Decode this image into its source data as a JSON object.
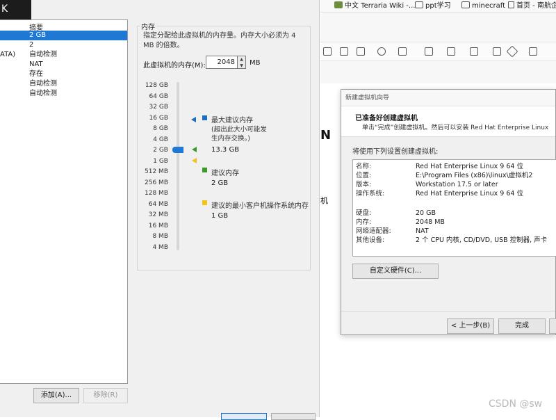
{
  "settings": {
    "close_glyph": "K",
    "list_header": "摘要",
    "rows": [
      {
        "device": "",
        "summary": "2 GB",
        "selected": true
      },
      {
        "device": "",
        "summary": "2"
      },
      {
        "device": "ATA)",
        "summary": "自动检测"
      },
      {
        "device": "",
        "summary": "NAT"
      },
      {
        "device": "",
        "summary": "存在"
      },
      {
        "device": "",
        "summary": "自动检测"
      },
      {
        "device": "",
        "summary": "自动检测"
      }
    ],
    "add_button": "添加(A)...",
    "remove_button": "移除(R)",
    "memory_group_title": "内存",
    "memory_desc": "指定分配给此虚拟机的内存量。内存大小必须为 4 MB 的倍数。",
    "memory_label": "此虚拟机的内存(M):",
    "memory_value": "2048",
    "memory_unit": "MB",
    "scale_labels": [
      "128 GB",
      "64 GB",
      "32 GB",
      "16 GB",
      "8 GB",
      "4 GB",
      "2 GB",
      "1 GB",
      "512 MB",
      "256 MB",
      "128 MB",
      "64 MB",
      "32 MB",
      "16 MB",
      "8 MB",
      "4 MB"
    ],
    "legend": {
      "max_label": "最大建议内存",
      "max_note": "(超出此大小可能发生内存交换。)",
      "max_value": "13.3 GB",
      "rec_label": "建议内存",
      "rec_value": "2 GB",
      "min_label": "建议的最小客户机操作系统内存",
      "min_value": "1 GB",
      "max_color": "#1e6fbf",
      "rec_color": "#3a9a2a",
      "min_color": "#f0c419"
    }
  },
  "browser": {
    "bookmarks": [
      "中文 Terraria Wiki -...",
      "ppt学习",
      "minecraft",
      "首页 - 南航企"
    ],
    "doc_fragment_1": "N",
    "doc_fragment_2": "机"
  },
  "wizard": {
    "title": "新建虚拟机向导",
    "heading": "已准备好创建虚拟机",
    "subheading": "单击“完成”创建虚拟机。然后可以安装 Red Hat Enterprise Linux",
    "lead": "将使用下列设置创建虚拟机:",
    "summary": [
      {
        "k": "名称:",
        "v": "Red Hat Enterprise Linux 9 64 位"
      },
      {
        "k": "位置:",
        "v": "E:\\Program Files (x86)\\linux\\虚拟机2"
      },
      {
        "k": "版本:",
        "v": "Workstation 17.5 or later"
      },
      {
        "k": "操作系统:",
        "v": "Red Hat Enterprise Linux 9 64 位"
      },
      {
        "k": "硬盘:",
        "v": "20 GB"
      },
      {
        "k": "内存:",
        "v": "2048 MB"
      },
      {
        "k": "网络适配器:",
        "v": "NAT"
      },
      {
        "k": "其他设备:",
        "v": "2 个 CPU 内核, CD/DVD, USB 控制器, 声卡"
      }
    ],
    "customize_button": "自定义硬件(C)...",
    "back_button": "< 上一步(B)",
    "finish_button": "完成"
  },
  "watermark": "CSDN @sw"
}
